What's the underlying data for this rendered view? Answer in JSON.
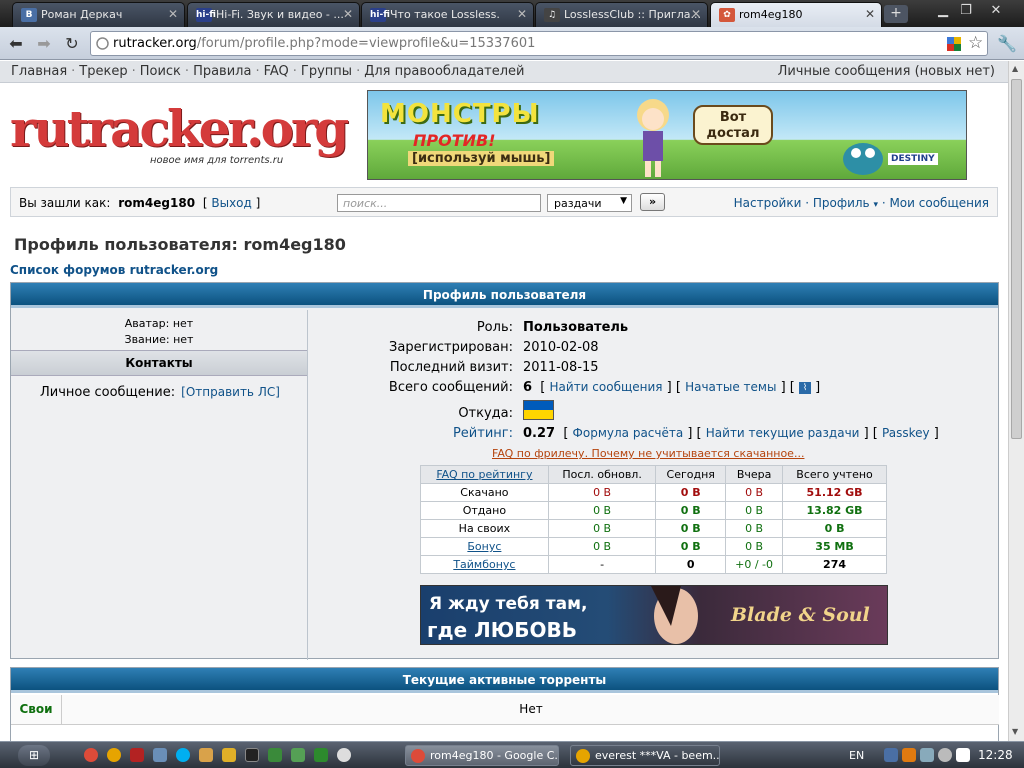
{
  "browser": {
    "tabs": [
      {
        "label": "Роман Деркач",
        "fav_color": "#4a6fa5",
        "fav_text": "В"
      },
      {
        "label": "Hi-Fi. Звук и видео - ...",
        "fav_color": "#2a3f8a",
        "fav_text": "hi-fi"
      },
      {
        "label": "Что такое Lossless.",
        "fav_color": "#2a3f8a",
        "fav_text": "hi-fi"
      },
      {
        "label": "LosslessClub :: Пригла...",
        "fav_color": "#444",
        "fav_text": "♫"
      },
      {
        "label": "rom4eg180",
        "fav_color": "#d4573b",
        "fav_text": "✿"
      }
    ],
    "new_tab": "+",
    "url_host": "rutracker.org",
    "url_path": "/forum/profile.php?mode=viewprofile&u=15337601"
  },
  "site": {
    "nav": [
      "Главная",
      "Трекер",
      "Поиск",
      "Правила",
      "FAQ",
      "Группы",
      "Для правообладателей"
    ],
    "nav_sep": "·",
    "pm": "Личные сообщения (новых нет)",
    "logo_text": "rutracker.org",
    "logo_sub": "новое имя для torrents.ru",
    "banner1": {
      "line1": "МОНСТРЫ",
      "line2": "ПРОТИВ!",
      "line3": "[используй мышь]",
      "bubble": "Вот достал",
      "brand": "DESTINY"
    },
    "userbar": {
      "login_label": "Вы зашли как:",
      "username": "rom4eg180",
      "logout": "Выход",
      "search_placeholder": "поиск...",
      "search_select": "раздачи",
      "go": "»",
      "links": [
        "Настройки",
        "Профиль",
        "Мои сообщения"
      ]
    },
    "page_title": "Профиль пользователя: rom4eg180",
    "forums_link": "Список форумов rutracker.org"
  },
  "profile": {
    "header": "Профиль пользователя",
    "avatar": "Аватар: нет",
    "rank": "Звание: нет",
    "contacts_header": "Контакты",
    "pm_label": "Личное сообщение:",
    "pm_link": "[Отправить ЛС]",
    "role_label": "Роль:",
    "role": "Пользователь",
    "reg_label": "Зарегистрирован:",
    "reg": "2010-02-08",
    "visit_label": "Последний визит:",
    "visit": "2011-08-15",
    "posts_label": "Всего сообщений:",
    "posts": "6",
    "find_posts": "Найти сообщения",
    "started_topics": "Начатые темы",
    "from_label": "Откуда:",
    "flag_colors": [
      "#005bbb",
      "#ffd500"
    ],
    "rating_label": "Рейтинг:",
    "rating": "0.27",
    "formula": "Формула расчёта",
    "find_current": "Найти текущие раздачи",
    "passkey": "Passkey",
    "faq_freeleech": "FAQ по фрилечу. Почему не учитывается скачанное..."
  },
  "stats": {
    "headers": [
      "FAQ по рейтингу",
      "Посл. обновл.",
      "Сегодня",
      "Вчера",
      "Всего учтено"
    ],
    "rows": [
      {
        "label": "Скачано",
        "link": false,
        "cells": [
          "0 B",
          "0 B",
          "0 B",
          "51.12 GB"
        ],
        "color": "red"
      },
      {
        "label": "Отдано",
        "link": false,
        "cells": [
          "0 B",
          "0 B",
          "0 B",
          "13.82 GB"
        ],
        "color": "grn"
      },
      {
        "label": "На своих",
        "link": false,
        "cells": [
          "0 B",
          "0 B",
          "0 B",
          "0 B"
        ],
        "color": "grn"
      },
      {
        "label": "Бонус",
        "link": true,
        "cells": [
          "0 B",
          "0 B",
          "0 B",
          "35 MB"
        ],
        "color": "grn"
      },
      {
        "label": "Таймбонус",
        "link": true,
        "cells": [
          "-",
          "0",
          "+0 / -0",
          "274"
        ],
        "color": "none"
      }
    ]
  },
  "banner2": {
    "line1": "Я жду тебя там,",
    "line2": "где ЛЮБОВЬ",
    "brand": "Blade & Soul"
  },
  "active": {
    "header": "Текущие активные торренты",
    "label": "Свои",
    "value": "Нет"
  },
  "taskbar": {
    "tasks": [
      "rom4eg180 - Google C...",
      "everest ***VA - beem..."
    ],
    "lang": "EN",
    "clock": "12:28"
  }
}
